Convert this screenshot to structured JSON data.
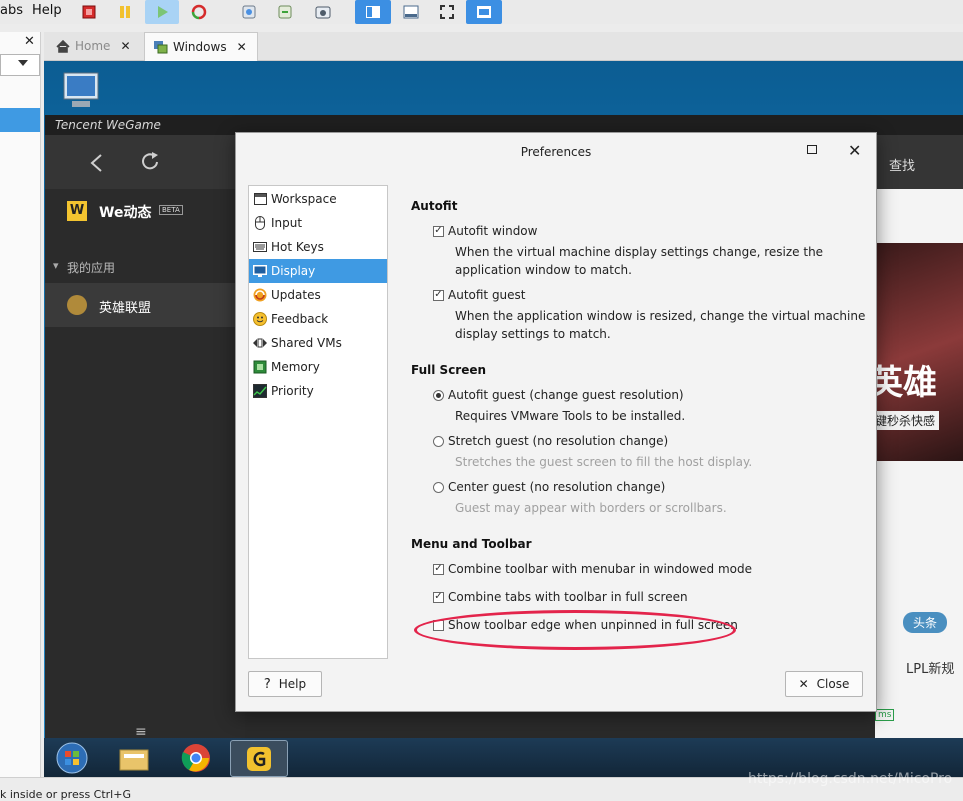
{
  "menubar": {
    "partial_tabs": "abs",
    "help": "Help"
  },
  "tabs": [
    {
      "label": "Home"
    },
    {
      "label": "Windows"
    }
  ],
  "tab_close_glyph": "✕",
  "left_panel": {
    "close_glyph": "✕"
  },
  "vm": {
    "wegame_brand": "Tencent WeGame",
    "nav_search": "查找",
    "we_title": "We动态",
    "beta": "BETA",
    "my_apps": "我的应用",
    "lol": "英雄联盟",
    "banner_text": "英雄",
    "banner_tag": "键秒杀快感",
    "news_tag": "头条",
    "news_text": "LPL新规",
    "badge_ms": "ms"
  },
  "dialog": {
    "title": "Preferences",
    "nav": [
      {
        "label": "Workspace",
        "icon": "workspace-icon"
      },
      {
        "label": "Input",
        "icon": "mouse-icon"
      },
      {
        "label": "Hot Keys",
        "icon": "keyboard-icon"
      },
      {
        "label": "Display",
        "icon": "monitor-icon"
      },
      {
        "label": "Updates",
        "icon": "updates-icon"
      },
      {
        "label": "Feedback",
        "icon": "smiley-icon"
      },
      {
        "label": "Shared VMs",
        "icon": "shared-vms-icon"
      },
      {
        "label": "Memory",
        "icon": "memory-chip-icon"
      },
      {
        "label": "Priority",
        "icon": "priority-icon"
      }
    ],
    "selected_nav": "Display",
    "autofit": {
      "heading": "Autofit",
      "window_label": "Autofit window",
      "window_checked": true,
      "window_desc_1": "When the virtual machine display settings change, resize the",
      "window_desc_2": "application window to match.",
      "guest_label": "Autofit guest",
      "guest_checked": true,
      "guest_desc_1": "When the application window is resized, change the virtual machine",
      "guest_desc_2": "display settings to match."
    },
    "fullscreen": {
      "heading": "Full Screen",
      "opt1_label": "Autofit guest (change guest resolution)",
      "opt1_desc": "Requires VMware Tools to be installed.",
      "opt2_label": "Stretch guest (no resolution change)",
      "opt2_desc": "Stretches the guest screen to fill the host display.",
      "opt3_label": "Center guest (no resolution change)",
      "opt3_desc": "Guest may appear with borders or scrollbars.",
      "selected": "opt1"
    },
    "menu_toolbar": {
      "heading": "Menu and Toolbar",
      "opt1_label": "Combine toolbar with menubar in windowed mode",
      "opt1_checked": true,
      "opt2_label": "Combine tabs with toolbar in full screen",
      "opt2_checked": true,
      "opt3_label": "Show toolbar edge when unpinned in full screen",
      "opt3_checked": false
    },
    "help_button": "Help",
    "close_button": "Close"
  },
  "statusbar": {
    "text": "k inside or press Ctrl+G"
  },
  "watermark": "https://blog.csdn.net/MicoPro",
  "colors": {
    "accent": "#3f9ae3",
    "highlight": "#e3244b"
  }
}
